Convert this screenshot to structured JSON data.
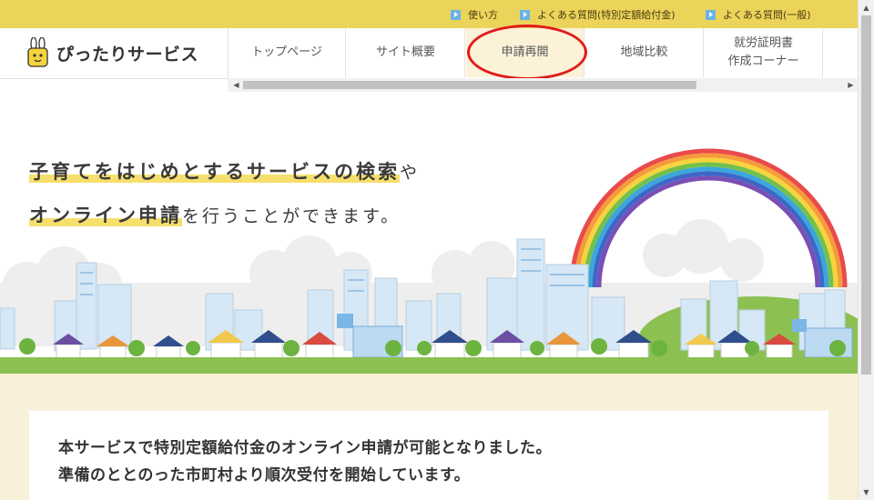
{
  "topbar": {
    "links": [
      {
        "label": "使い方",
        "icon": "play-icon"
      },
      {
        "label": "よくある質問(特別定額給付金)",
        "icon": "play-icon"
      },
      {
        "label": "よくある質問(一般)",
        "icon": "play-icon"
      }
    ]
  },
  "header": {
    "logo_title": "ぴったりサービス",
    "logo_icon": "rabbit-mascot-icon"
  },
  "nav": {
    "items": [
      {
        "label": "トップページ"
      },
      {
        "label": "サイト概要"
      },
      {
        "label": "申請再開",
        "active": true
      },
      {
        "label": "地域比較"
      },
      {
        "label_line1": "就労証明書",
        "label_line2": "作成コーナー"
      }
    ]
  },
  "hero": {
    "line1_highlight": "子育てをはじめとするサービスの検索",
    "line1_rest": "や",
    "line2_highlight": "オンライン申請",
    "line2_rest": "を行うことができます。"
  },
  "notice": {
    "line1": "本サービスで特別定額給付金のオンライン申請が可能となりました。",
    "line2": "準備のととのった市町村より順次受付を開始しています。"
  },
  "colors": {
    "topbar": "#ecd45a",
    "highlight": "#f6df6c",
    "lower_bg": "#f8f0d8",
    "annotation_ring": "#e21b1b",
    "grass": "#8cc152"
  }
}
